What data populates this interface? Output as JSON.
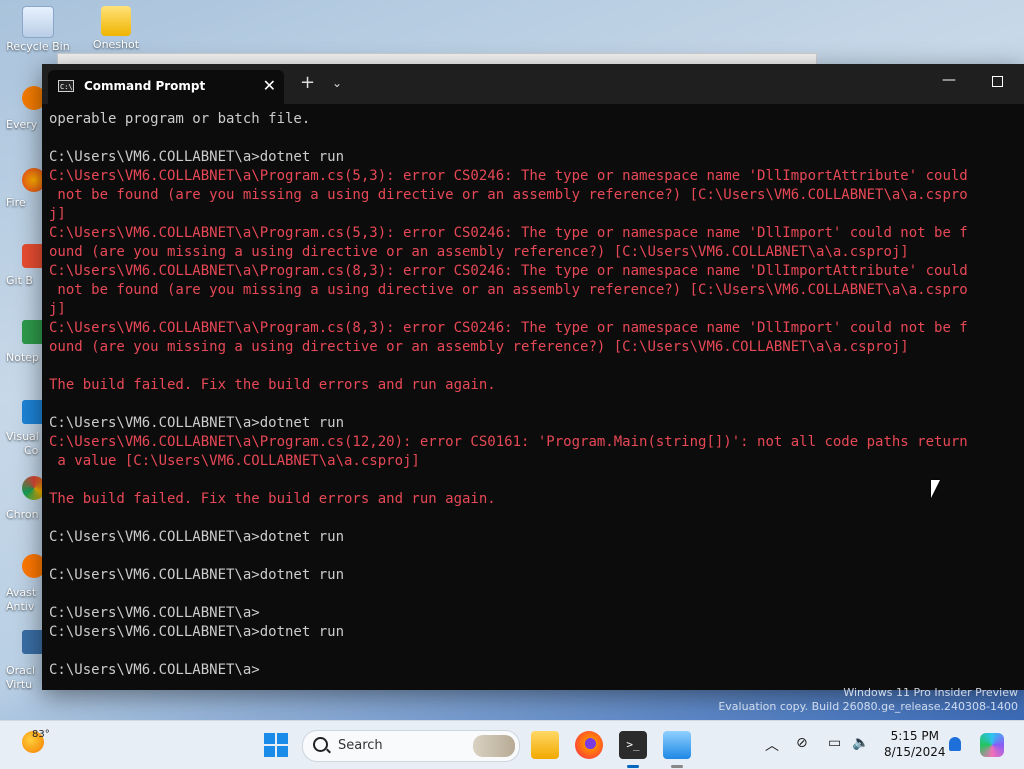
{
  "desktop": {
    "icons": [
      {
        "label": "Recycle Bin",
        "icon": "recycle-bin-icon"
      },
      {
        "label": "Oneshot",
        "icon": "folder-icon"
      }
    ],
    "partial_labels": [
      "Every",
      "Fire",
      "Git B",
      "Notep",
      "Visual",
      "Co",
      "Chron",
      "Avast",
      "Antiv",
      "Oracl",
      "Virtu"
    ]
  },
  "window": {
    "tab_title": "Command Prompt",
    "tab_icon": "C:\\",
    "new_tab": "+",
    "dropdown": "⌄",
    "minimize": "—"
  },
  "console": {
    "lines": [
      {
        "text": "operable program or batch file.",
        "type": "out"
      },
      {
        "text": "",
        "type": "out"
      },
      {
        "text": "C:\\Users\\VM6.COLLABNET\\a>dotnet run",
        "type": "out"
      },
      {
        "text": "C:\\Users\\VM6.COLLABNET\\a\\Program.cs(5,3): error CS0246: The type or namespace name 'DllImportAttribute' could",
        "type": "err"
      },
      {
        "text": " not be found (are you missing a using directive or an assembly reference?) [C:\\Users\\VM6.COLLABNET\\a\\a.cspro",
        "type": "err"
      },
      {
        "text": "j]",
        "type": "err"
      },
      {
        "text": "C:\\Users\\VM6.COLLABNET\\a\\Program.cs(5,3): error CS0246: The type or namespace name 'DllImport' could not be f",
        "type": "err"
      },
      {
        "text": "ound (are you missing a using directive or an assembly reference?) [C:\\Users\\VM6.COLLABNET\\a\\a.csproj]",
        "type": "err"
      },
      {
        "text": "C:\\Users\\VM6.COLLABNET\\a\\Program.cs(8,3): error CS0246: The type or namespace name 'DllImportAttribute' could",
        "type": "err"
      },
      {
        "text": " not be found (are you missing a using directive or an assembly reference?) [C:\\Users\\VM6.COLLABNET\\a\\a.cspro",
        "type": "err"
      },
      {
        "text": "j]",
        "type": "err"
      },
      {
        "text": "C:\\Users\\VM6.COLLABNET\\a\\Program.cs(8,3): error CS0246: The type or namespace name 'DllImport' could not be f",
        "type": "err"
      },
      {
        "text": "ound (are you missing a using directive or an assembly reference?) [C:\\Users\\VM6.COLLABNET\\a\\a.csproj]",
        "type": "err"
      },
      {
        "text": "",
        "type": "out"
      },
      {
        "text": "The build failed. Fix the build errors and run again.",
        "type": "err"
      },
      {
        "text": "",
        "type": "out"
      },
      {
        "text": "C:\\Users\\VM6.COLLABNET\\a>dotnet run",
        "type": "out"
      },
      {
        "text": "C:\\Users\\VM6.COLLABNET\\a\\Program.cs(12,20): error CS0161: 'Program.Main(string[])': not all code paths return",
        "type": "err"
      },
      {
        "text": " a value [C:\\Users\\VM6.COLLABNET\\a\\a.csproj]",
        "type": "err"
      },
      {
        "text": "",
        "type": "out"
      },
      {
        "text": "The build failed. Fix the build errors and run again.",
        "type": "err"
      },
      {
        "text": "",
        "type": "out"
      },
      {
        "text": "C:\\Users\\VM6.COLLABNET\\a>dotnet run",
        "type": "out"
      },
      {
        "text": "",
        "type": "out"
      },
      {
        "text": "C:\\Users\\VM6.COLLABNET\\a>dotnet run",
        "type": "out"
      },
      {
        "text": "",
        "type": "out"
      },
      {
        "text": "C:\\Users\\VM6.COLLABNET\\a>",
        "type": "out"
      },
      {
        "text": "C:\\Users\\VM6.COLLABNET\\a>dotnet run",
        "type": "out"
      },
      {
        "text": "",
        "type": "out"
      },
      {
        "text": "C:\\Users\\VM6.COLLABNET\\a>",
        "type": "out"
      }
    ]
  },
  "watermark": {
    "line1": "Windows 11 Pro Insider Preview",
    "line2": "Evaluation copy. Build 26080.ge_release.240308-1400"
  },
  "taskbar": {
    "temperature": "83°",
    "search_placeholder": "Search",
    "apps": [
      "file-explorer-icon",
      "firefox-icon",
      "terminal-icon",
      "notepad-icon"
    ],
    "tray_icons": [
      "chevron-up-icon",
      "network-icon",
      "display-icon",
      "volume-icon"
    ],
    "time": "5:15 PM",
    "date": "8/15/2024"
  },
  "colors": {
    "console_text": "#cccccc",
    "console_error": "#e74856",
    "console_bg": "#0c0c0c"
  }
}
